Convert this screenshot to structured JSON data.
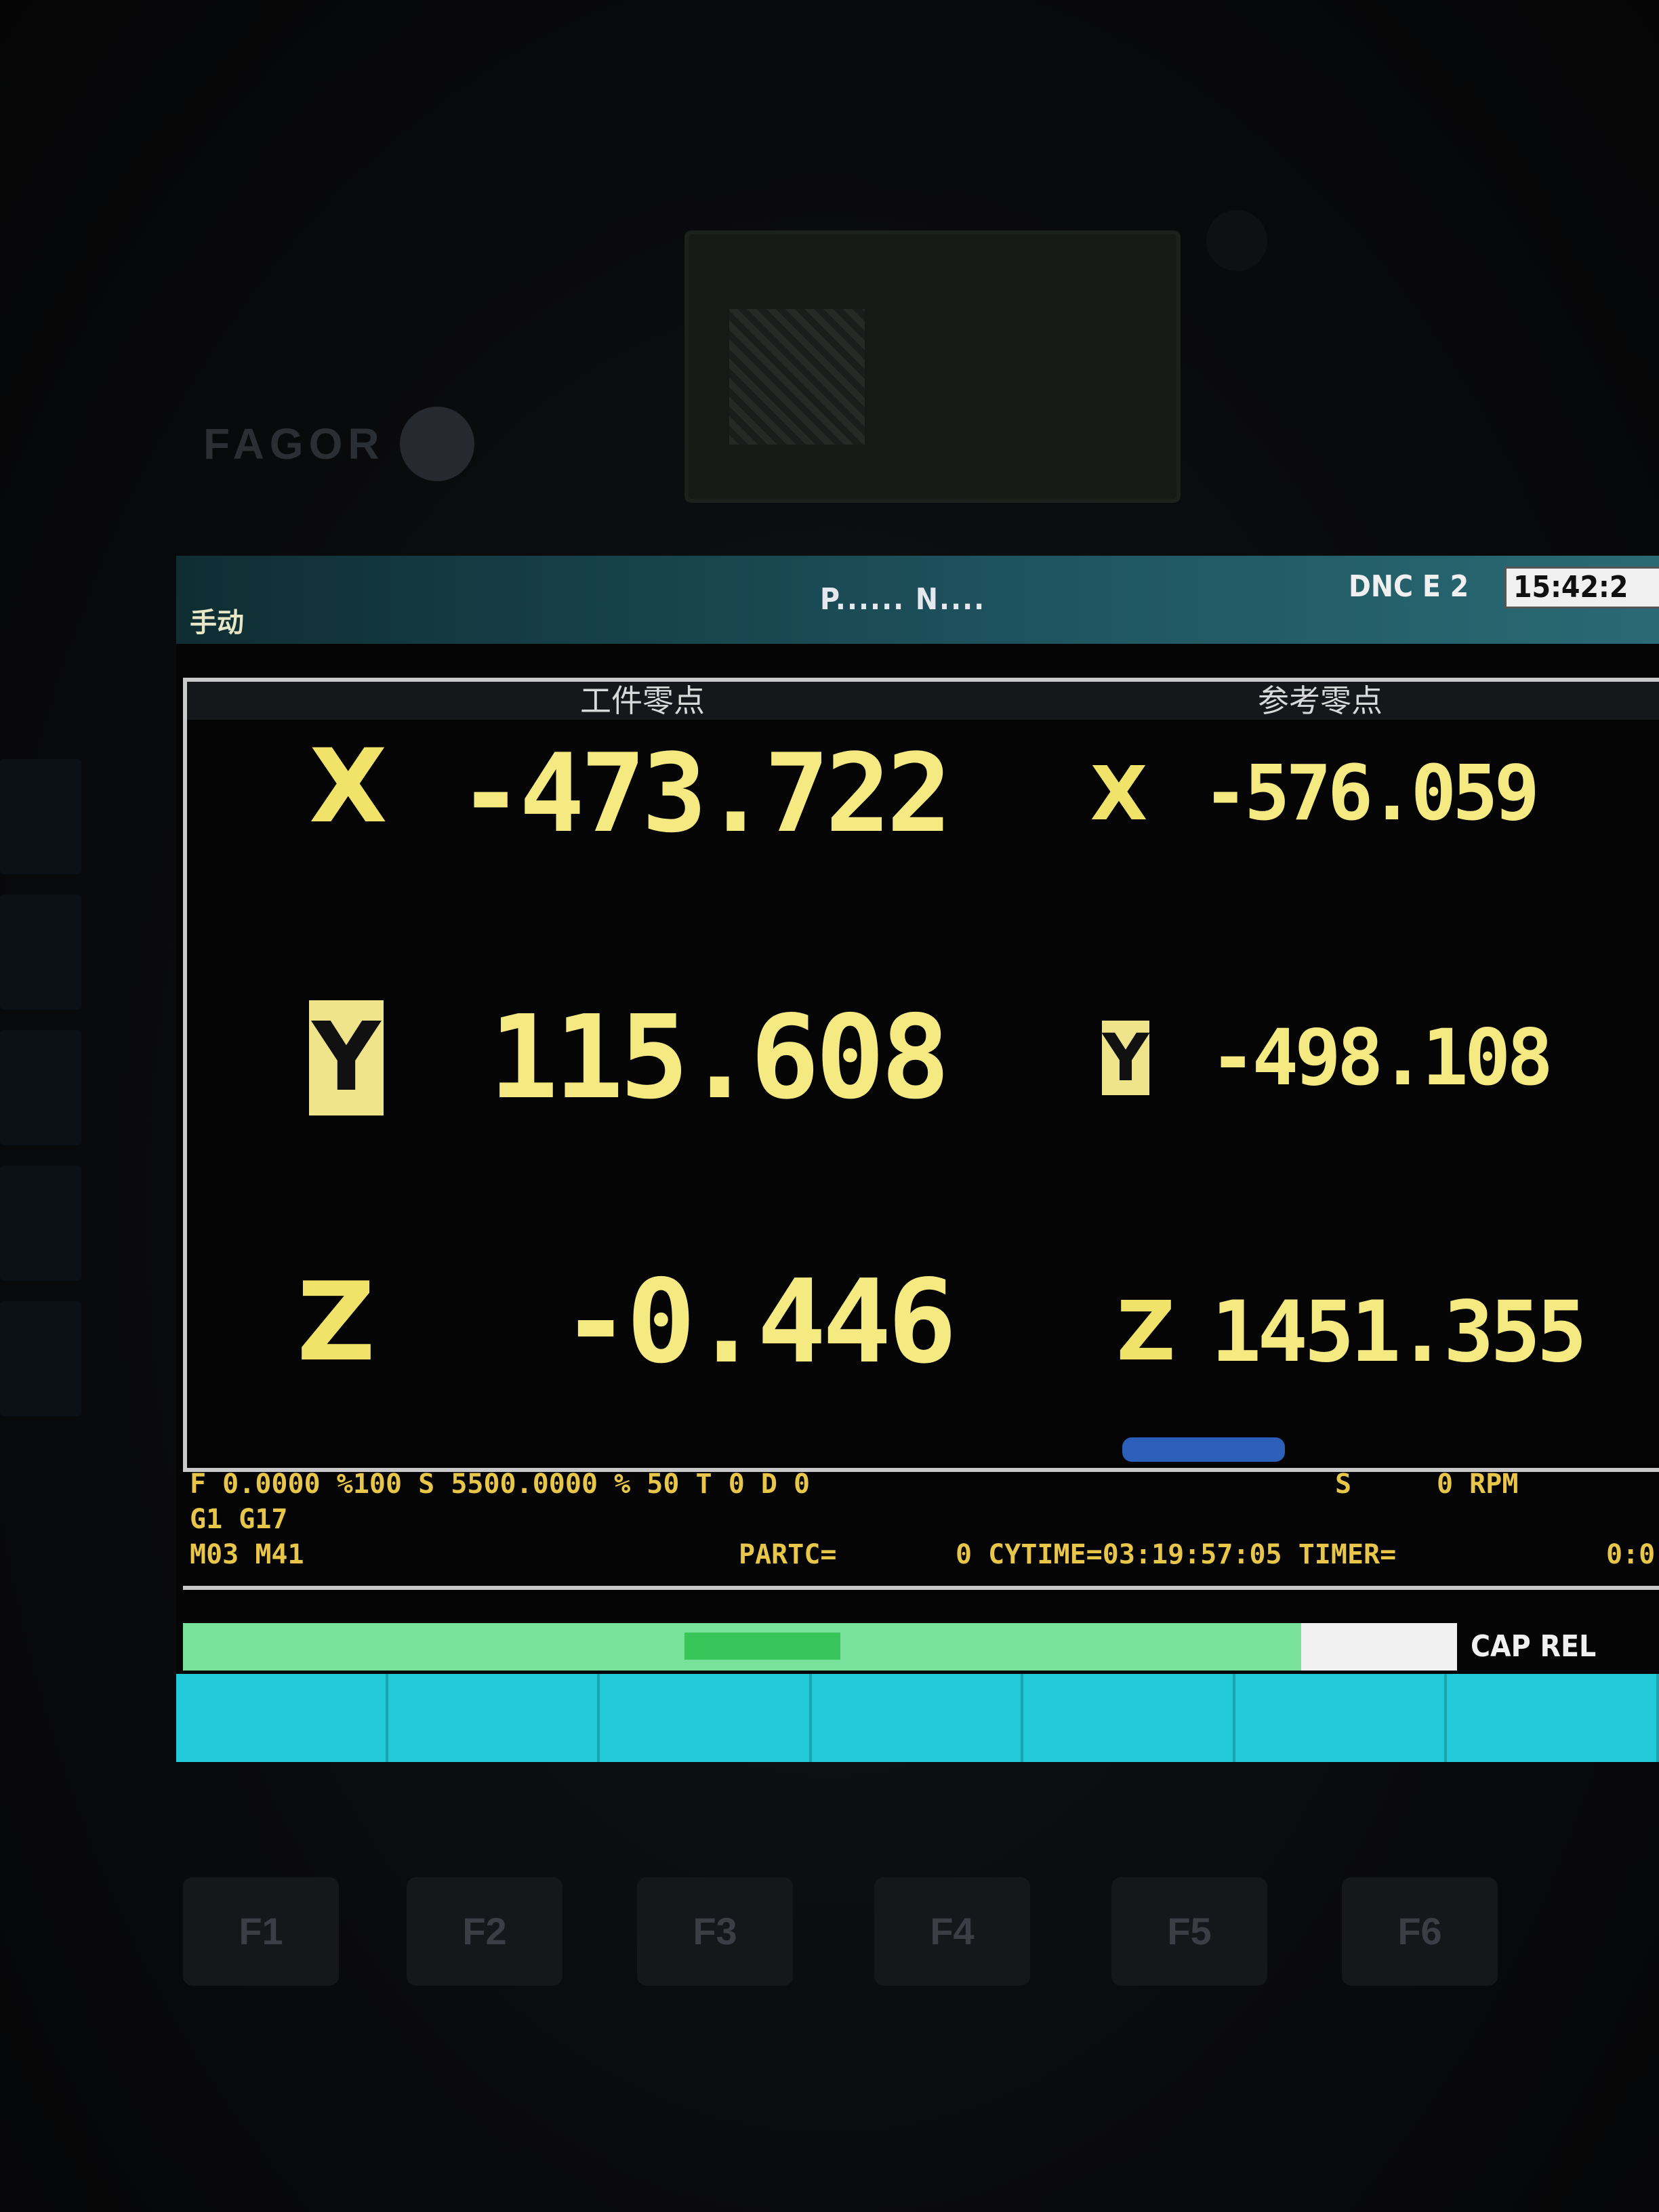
{
  "device": {
    "brand": "FAGOR"
  },
  "titlebar": {
    "mode": "手动",
    "program": "P...... N....",
    "dnc": "DNC E 2",
    "clock": "15:42:2"
  },
  "panel": {
    "left_title": "工件零点",
    "right_title": "参考零点",
    "work_coords": [
      {
        "axis": "X",
        "value": "-473.722"
      },
      {
        "axis": "Y",
        "value": "115.608"
      },
      {
        "axis": "Z",
        "value": "-0.446"
      }
    ],
    "ref_coords": [
      {
        "axis": "X",
        "value": "-576.059"
      },
      {
        "axis": "Y",
        "value": "-498.108"
      },
      {
        "axis": "Z",
        "value": "1451.355"
      }
    ]
  },
  "status": {
    "line1": "F   0.0000 %100 S 5500.0000 % 50 T   0 D   0",
    "spindle": "S",
    "rpm": "0 RPM",
    "line2": "G1 G17",
    "line3": "M03 M41",
    "partc": "PARTC=",
    "cytime": "0 CYTIME=03:19:57:05 TIMER=",
    "timer": "0:0"
  },
  "bottom": {
    "cap_label": "CAP REL"
  },
  "fkeys": [
    "F1",
    "F2",
    "F3",
    "F4",
    "F5",
    "F6"
  ]
}
